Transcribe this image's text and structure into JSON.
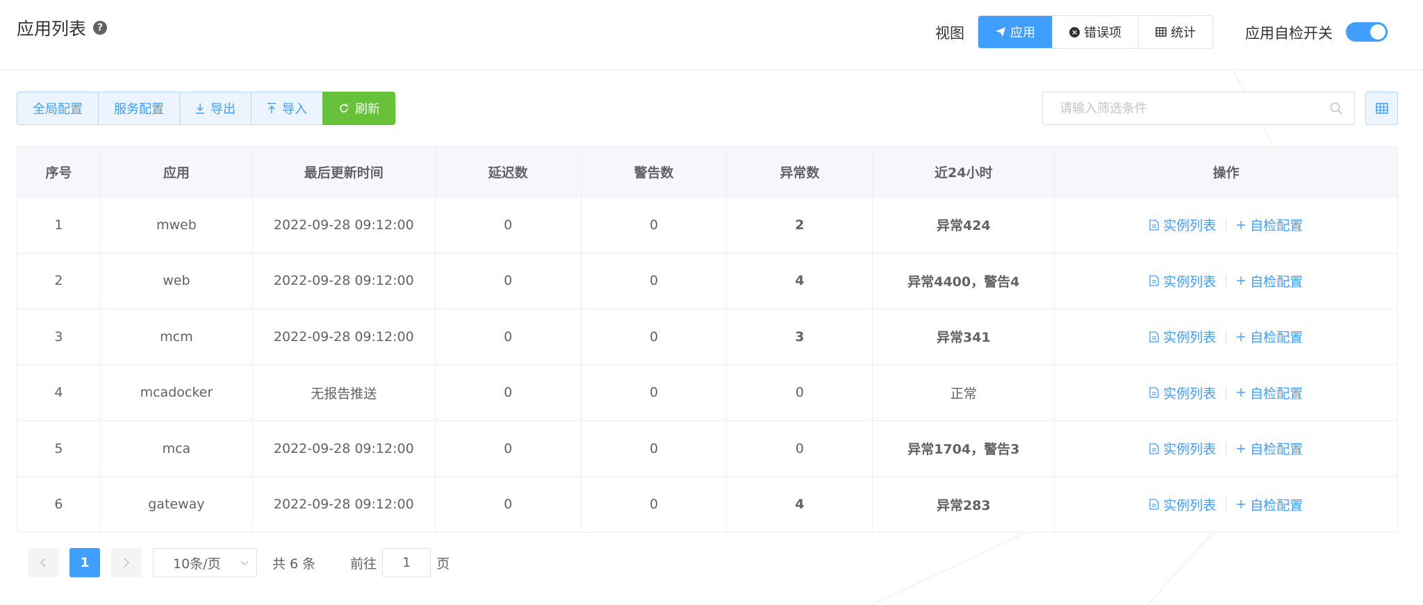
{
  "header": {
    "title": "应用列表",
    "view_label": "视图",
    "views": [
      {
        "label": "应用",
        "active": true
      },
      {
        "label": "错误项",
        "active": false
      },
      {
        "label": "统计",
        "active": false
      }
    ],
    "selfcheck_label": "应用自检开关"
  },
  "toolbar": {
    "global_config": "全局配置",
    "service_config": "服务配置",
    "export": "导出",
    "import": "导入",
    "refresh": "刷新",
    "search_placeholder": "请输入筛选条件"
  },
  "table": {
    "columns": [
      "序号",
      "应用",
      "最后更新时间",
      "延迟数",
      "警告数",
      "异常数",
      "近24小时",
      "操作"
    ],
    "rows": [
      {
        "idx": "1",
        "app": "mweb",
        "updated": "2022-09-28 09:12:00",
        "delay": "0",
        "warn": "0",
        "error": "2",
        "recent": "异常424",
        "status": "error"
      },
      {
        "idx": "2",
        "app": "web",
        "updated": "2022-09-28 09:12:00",
        "delay": "0",
        "warn": "0",
        "error": "4",
        "recent": "异常4400，警告4",
        "status": "error"
      },
      {
        "idx": "3",
        "app": "mcm",
        "updated": "2022-09-28 09:12:00",
        "delay": "0",
        "warn": "0",
        "error": "3",
        "recent": "异常341",
        "status": "error"
      },
      {
        "idx": "4",
        "app": "mcadocker",
        "updated": "无报告推送",
        "delay": "0",
        "warn": "0",
        "error": "0",
        "recent": "正常",
        "status": "ok"
      },
      {
        "idx": "5",
        "app": "mca",
        "updated": "2022-09-28 09:12:00",
        "delay": "0",
        "warn": "0",
        "error": "0",
        "recent": "异常1704，警告3",
        "status": "error"
      },
      {
        "idx": "6",
        "app": "gateway",
        "updated": "2022-09-28 09:12:00",
        "delay": "0",
        "warn": "0",
        "error": "4",
        "recent": "异常283",
        "status": "error"
      }
    ],
    "op_instances": "实例列表",
    "op_selfcheck": "自检配置"
  },
  "pagination": {
    "current": "1",
    "page_size": "10条/页",
    "total": "共 6 条",
    "goto": "前往",
    "goto_value": "1",
    "page_suffix": "页"
  },
  "colors": {
    "primary": "#409eff",
    "success": "#67c23a",
    "danger": "#f56c6c"
  }
}
